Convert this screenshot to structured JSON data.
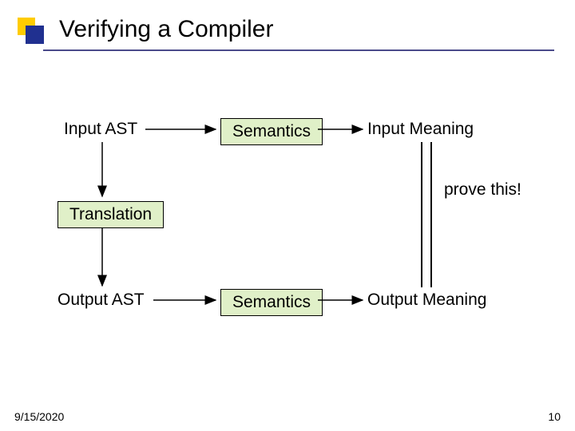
{
  "title": "Verifying a Compiler",
  "nodes": {
    "input_ast": "Input AST",
    "semantics_top": "Semantics",
    "input_meaning": "Input Meaning",
    "translation": "Translation",
    "output_ast": "Output AST",
    "semantics_bottom": "Semantics",
    "output_meaning": "Output Meaning",
    "prove_this": "prove this!"
  },
  "footer": {
    "date": "9/15/2020",
    "page": "10"
  },
  "chart_data": {
    "type": "diagram",
    "title": "Verifying a Compiler",
    "nodes": [
      {
        "id": "input_ast",
        "label": "Input AST",
        "boxed": false
      },
      {
        "id": "semantics_top",
        "label": "Semantics",
        "boxed": true
      },
      {
        "id": "input_meaning",
        "label": "Input Meaning",
        "boxed": false
      },
      {
        "id": "translation",
        "label": "Translation",
        "boxed": true
      },
      {
        "id": "output_ast",
        "label": "Output AST",
        "boxed": false
      },
      {
        "id": "semantics_bottom",
        "label": "Semantics",
        "boxed": true
      },
      {
        "id": "output_meaning",
        "label": "Output Meaning",
        "boxed": false
      }
    ],
    "edges": [
      {
        "from": "input_ast",
        "to": "semantics_top",
        "style": "arrow"
      },
      {
        "from": "semantics_top",
        "to": "input_meaning",
        "style": "arrow"
      },
      {
        "from": "input_ast",
        "to": "translation",
        "style": "arrow"
      },
      {
        "from": "translation",
        "to": "output_ast",
        "style": "arrow"
      },
      {
        "from": "output_ast",
        "to": "semantics_bottom",
        "style": "arrow"
      },
      {
        "from": "semantics_bottom",
        "to": "output_meaning",
        "style": "arrow"
      },
      {
        "from": "input_meaning",
        "to": "output_meaning",
        "style": "equals",
        "annotation": "prove this!"
      }
    ]
  }
}
